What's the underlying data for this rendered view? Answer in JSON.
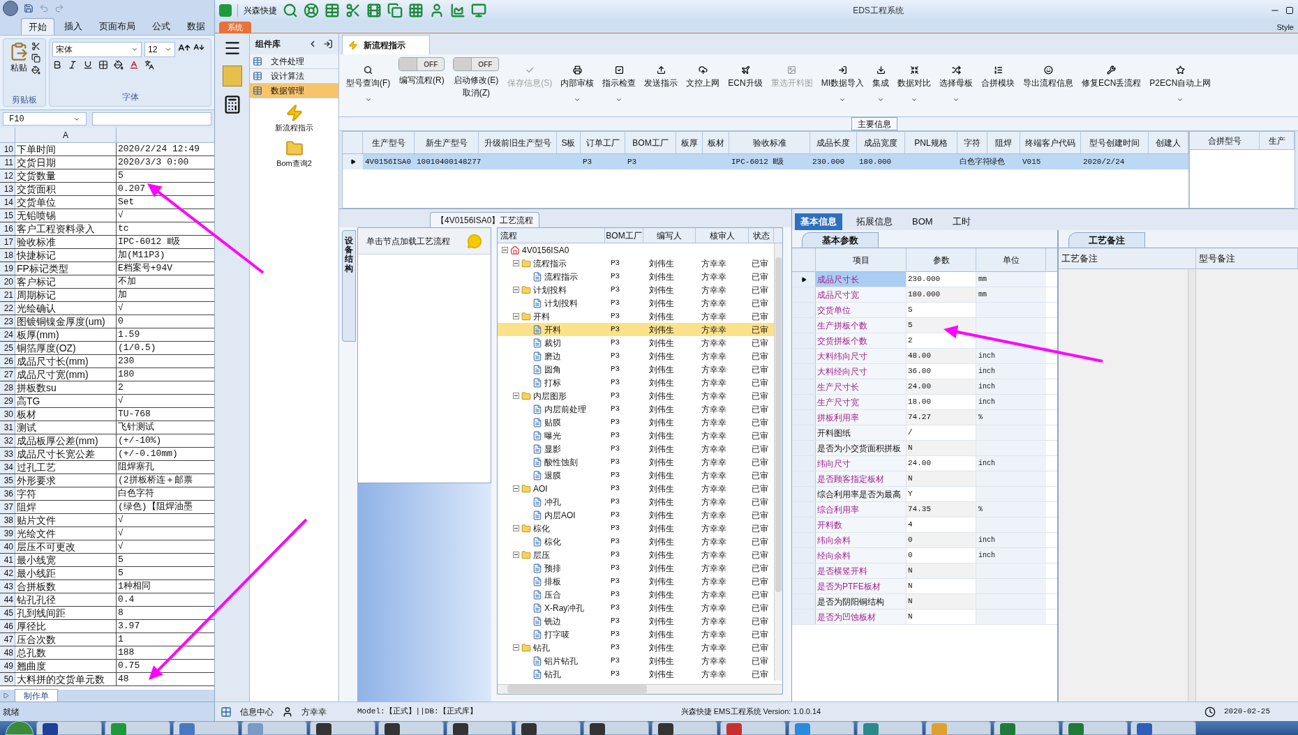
{
  "excel": {
    "tabs": [
      {
        "label": "开始",
        "selected": true
      },
      {
        "label": "插入",
        "selected": false
      },
      {
        "label": "页面布局",
        "selected": false
      },
      {
        "label": "公式",
        "selected": false
      },
      {
        "label": "数据",
        "selected": false
      }
    ],
    "paste_label": "粘贴",
    "clipboard_group": "剪贴板",
    "font_name": "宋体",
    "font_size": "12",
    "font_group": "字体",
    "name_box": "F10",
    "column_a": "A",
    "rows": [
      [
        "10",
        "下单时间",
        "2020/2/24 12:49"
      ],
      [
        "11",
        "交货日期",
        "2020/3/3 0:00"
      ],
      [
        "12",
        "交货数量",
        "5"
      ],
      [
        "13",
        "交货面积",
        "0.207"
      ],
      [
        "14",
        "交货单位",
        "Set"
      ],
      [
        "15",
        "无铅喷锡",
        "√"
      ],
      [
        "16",
        "客户工程资料录入",
        "tc"
      ],
      [
        "17",
        "验收标准",
        "IPC-6012 Ⅱ级"
      ],
      [
        "18",
        "快捷标记",
        "加(M11P3)"
      ],
      [
        "19",
        "FP标记类型",
        "E档案号+94V"
      ],
      [
        "20",
        "客户标记",
        "不加"
      ],
      [
        "21",
        "周期标记",
        "加"
      ],
      [
        "22",
        "光绘确认",
        "√"
      ],
      [
        "23",
        "图镀铜镍金厚度(um)",
        "0"
      ],
      [
        "24",
        "板厚(mm)",
        "1.59"
      ],
      [
        "25",
        "铜箔厚度(OZ)",
        "(1/0.5)"
      ],
      [
        "26",
        "成品尺寸长(mm)",
        "230"
      ],
      [
        "27",
        "成品尺寸宽(mm)",
        "180"
      ],
      [
        "28",
        "拼板数su",
        "2"
      ],
      [
        "29",
        "高TG",
        "√"
      ],
      [
        "30",
        "板材",
        "TU-768"
      ],
      [
        "31",
        "测试",
        "飞针测试"
      ],
      [
        "32",
        "成品板厚公差(mm)",
        "(+/-10%)"
      ],
      [
        "33",
        "成品尺寸长宽公差",
        "(+/-0.10mm)"
      ],
      [
        "34",
        "过孔工艺",
        "阻焊塞孔"
      ],
      [
        "35",
        "外形要求",
        "(2拼板桥连＋邮票"
      ],
      [
        "36",
        "字符",
        "白色字符"
      ],
      [
        "37",
        "阻焊",
        "(绿色)【阻焊油墨"
      ],
      [
        "38",
        "贴片文件",
        "√"
      ],
      [
        "39",
        "光绘文件",
        "√"
      ],
      [
        "40",
        "层压不可更改",
        "√"
      ],
      [
        "41",
        "最小线宽",
        "5"
      ],
      [
        "42",
        "最小线距",
        "5"
      ],
      [
        "43",
        "合拼板数",
        "1种相同"
      ],
      [
        "44",
        "钻孔孔径",
        "0.4"
      ],
      [
        "45",
        "孔到线间距",
        "8"
      ],
      [
        "46",
        "厚径比",
        "3.97"
      ],
      [
        "47",
        "压合次数",
        "1"
      ],
      [
        "48",
        "总孔数",
        "188"
      ],
      [
        "49",
        "翘曲度",
        "0.75"
      ],
      [
        "50",
        "大料拼的交货单元数",
        "48"
      ]
    ],
    "sheet_tab": "制作单",
    "status": "就绪"
  },
  "app": {
    "quick_label": "兴森快捷",
    "title": "EDS工程系统",
    "system_tab": "系统",
    "style_label": "Style",
    "library": {
      "title": "组件库",
      "items": [
        {
          "label": "文件处理",
          "selected": false
        },
        {
          "label": "设计算法",
          "selected": false
        },
        {
          "label": "数据管理",
          "selected": true
        }
      ],
      "tools": [
        {
          "kind": "lightning",
          "label": "新流程指示"
        },
        {
          "kind": "folder",
          "label": "Bom查询2"
        }
      ]
    },
    "doc_tab": "新流程指示",
    "ribbon": [
      {
        "kind": "button",
        "label": "型号查询(F)",
        "dropdown": true,
        "disabled": false
      },
      {
        "kind": "toggle",
        "label": "编写流程(R)",
        "state_text": "OFF",
        "on": false
      },
      {
        "kind": "toggle",
        "label": "启动修改(E)",
        "label2": "取消(Z)",
        "state_text": "OFF",
        "on": false
      },
      {
        "kind": "button",
        "label": "保存信息(S)",
        "dropdown": false,
        "disabled": true
      },
      {
        "kind": "button",
        "label": "内部审核",
        "dropdown": true,
        "disabled": false
      },
      {
        "kind": "button",
        "label": "指示检查",
        "dropdown": true,
        "disabled": false
      },
      {
        "kind": "button",
        "label": "发送指示",
        "dropdown": false,
        "disabled": false
      },
      {
        "kind": "button",
        "label": "文控上网",
        "dropdown": false,
        "disabled": false
      },
      {
        "kind": "button",
        "label": "ECN升级",
        "dropdown": false,
        "disabled": false
      },
      {
        "kind": "button",
        "label": "重选开料图",
        "dropdown": false,
        "disabled": true
      },
      {
        "kind": "button",
        "label": "MI数据导入",
        "dropdown": true,
        "disabled": false
      },
      {
        "kind": "button",
        "label": "集成",
        "dropdown": true,
        "disabled": false
      },
      {
        "kind": "button",
        "label": "数据对比",
        "dropdown": true,
        "disabled": false
      },
      {
        "kind": "button",
        "label": "选择母板",
        "dropdown": true,
        "disabled": false
      },
      {
        "kind": "button",
        "label": "合拼模块",
        "dropdown": false,
        "disabled": false
      },
      {
        "kind": "button",
        "label": "导出流程信息",
        "dropdown": false,
        "disabled": false
      },
      {
        "kind": "button",
        "label": "修复ECN丢流程",
        "dropdown": false,
        "disabled": false
      },
      {
        "kind": "button",
        "label": "P2ECN自动上网",
        "dropdown": true,
        "disabled": false
      }
    ],
    "main_info": {
      "title": "主要信息",
      "columns": [
        "生产型号",
        "新生产型号",
        "升级前旧生产型号",
        "S板",
        "订单工厂",
        "BOM工厂",
        "板厚",
        "板材",
        "验收标准",
        "成品长度",
        "成品宽度",
        "PNL规格",
        "字符",
        "阻焊",
        "终端客户代码",
        "型号创建时间",
        "创建人"
      ],
      "row": {
        "selected": true,
        "cells": [
          "4V0156ISA0",
          "10010400148277",
          null,
          null,
          "P3",
          "P3",
          null,
          null,
          "IPC-6012 Ⅱ级",
          "230.000",
          "180.000",
          null,
          "白色字符",
          "绿色",
          "V015",
          "2020/2/24",
          null
        ]
      },
      "side_columns": [
        "合拼型号",
        "生产"
      ]
    },
    "flow": {
      "title": "【4V0156ISA0】工艺流程",
      "side_tab": "设备结构",
      "hint": "单击节点加载工艺流程",
      "columns": [
        "流程",
        "BOM工厂",
        "编写人",
        "核审人",
        "状态"
      ],
      "tree": [
        {
          "name": "4V0156ISA0",
          "kind": "root",
          "selected": false,
          "expanded": true,
          "children": [
            {
              "name": "流程指示",
              "kind": "folder",
              "bom": "P3",
              "writer": "刘伟生",
              "reviewer": "方幸幸",
              "status": "已审",
              "selected": false,
              "expanded": true,
              "children": [
                {
                  "name": "流程指示",
                  "kind": "step",
                  "bom": "P3",
                  "writer": "刘伟生",
                  "reviewer": "方幸幸",
                  "status": "已审",
                  "selected": false
                }
              ]
            },
            {
              "name": "计划投料",
              "kind": "folder",
              "bom": "P3",
              "writer": "刘伟生",
              "reviewer": "方幸幸",
              "status": "已审",
              "selected": false,
              "expanded": true,
              "children": [
                {
                  "name": "计划投料",
                  "kind": "step",
                  "bom": "P3",
                  "writer": "刘伟生",
                  "reviewer": "方幸幸",
                  "status": "已审",
                  "selected": false
                }
              ]
            },
            {
              "name": "开料",
              "kind": "folder",
              "bom": "P3",
              "writer": "刘伟生",
              "reviewer": "方幸幸",
              "status": "已审",
              "selected": false,
              "expanded": true,
              "children": [
                {
                  "name": "开料",
                  "kind": "step",
                  "bom": "P3",
                  "writer": "刘伟生",
                  "reviewer": "方幸幸",
                  "status": "已审",
                  "selected": true
                },
                {
                  "name": "裁切",
                  "kind": "step",
                  "bom": "P3",
                  "writer": "刘伟生",
                  "reviewer": "方幸幸",
                  "status": "已审",
                  "selected": false
                },
                {
                  "name": "磨边",
                  "kind": "step",
                  "bom": "P3",
                  "writer": "刘伟生",
                  "reviewer": "方幸幸",
                  "status": "已审",
                  "selected": false
                },
                {
                  "name": "圆角",
                  "kind": "step",
                  "bom": "P3",
                  "writer": "刘伟生",
                  "reviewer": "方幸幸",
                  "status": "已审",
                  "selected": false
                },
                {
                  "name": "打标",
                  "kind": "step",
                  "bom": "P3",
                  "writer": "刘伟生",
                  "reviewer": "方幸幸",
                  "status": "已审",
                  "selected": false
                }
              ]
            },
            {
              "name": "内层图形",
              "kind": "folder",
              "bom": "P3",
              "writer": "刘伟生",
              "reviewer": "方幸幸",
              "status": "已审",
              "selected": false,
              "expanded": true,
              "children": [
                {
                  "name": "内层前处理",
                  "kind": "step",
                  "bom": "P3",
                  "writer": "刘伟生",
                  "reviewer": "方幸幸",
                  "status": "已审",
                  "selected": false
                },
                {
                  "name": "贴膜",
                  "kind": "step",
                  "bom": "P3",
                  "writer": "刘伟生",
                  "reviewer": "方幸幸",
                  "status": "已审",
                  "selected": false
                },
                {
                  "name": "曝光",
                  "kind": "step",
                  "bom": "P3",
                  "writer": "刘伟生",
                  "reviewer": "方幸幸",
                  "status": "已审",
                  "selected": false
                },
                {
                  "name": "显影",
                  "kind": "step",
                  "bom": "P3",
                  "writer": "刘伟生",
                  "reviewer": "方幸幸",
                  "status": "已审",
                  "selected": false
                },
                {
                  "name": "酸性蚀刻",
                  "kind": "step",
                  "bom": "P3",
                  "writer": "刘伟生",
                  "reviewer": "方幸幸",
                  "status": "已审",
                  "selected": false
                },
                {
                  "name": "退膜",
                  "kind": "step",
                  "bom": "P3",
                  "writer": "刘伟生",
                  "reviewer": "方幸幸",
                  "status": "已审",
                  "selected": false
                }
              ]
            },
            {
              "name": "AOI",
              "kind": "folder",
              "bom": "P3",
              "writer": "刘伟生",
              "reviewer": "方幸幸",
              "status": "已审",
              "selected": false,
              "expanded": true,
              "children": [
                {
                  "name": "冲孔",
                  "kind": "step",
                  "bom": "P3",
                  "writer": "刘伟生",
                  "reviewer": "方幸幸",
                  "status": "已审",
                  "selected": false
                },
                {
                  "name": "内层AOI",
                  "kind": "step",
                  "bom": "P3",
                  "writer": "刘伟生",
                  "reviewer": "方幸幸",
                  "status": "已审",
                  "selected": false
                }
              ]
            },
            {
              "name": "棕化",
              "kind": "folder",
              "bom": "P3",
              "writer": "刘伟生",
              "reviewer": "方幸幸",
              "status": "已审",
              "selected": false,
              "expanded": true,
              "children": [
                {
                  "name": "棕化",
                  "kind": "step",
                  "bom": "P3",
                  "writer": "刘伟生",
                  "reviewer": "方幸幸",
                  "status": "已审",
                  "selected": false
                }
              ]
            },
            {
              "name": "层压",
              "kind": "folder",
              "bom": "P3",
              "writer": "刘伟生",
              "reviewer": "方幸幸",
              "status": "已审",
              "selected": false,
              "expanded": true,
              "children": [
                {
                  "name": "预排",
                  "kind": "step",
                  "bom": "P3",
                  "writer": "刘伟生",
                  "reviewer": "方幸幸",
                  "status": "已审",
                  "selected": false
                },
                {
                  "name": "排板",
                  "kind": "step",
                  "bom": "P3",
                  "writer": "刘伟生",
                  "reviewer": "方幸幸",
                  "status": "已审",
                  "selected": false
                },
                {
                  "name": "压合",
                  "kind": "step",
                  "bom": "P3",
                  "writer": "刘伟生",
                  "reviewer": "方幸幸",
                  "status": "已审",
                  "selected": false
                },
                {
                  "name": "X-Ray冲孔",
                  "kind": "step",
                  "bom": "P3",
                  "writer": "刘伟生",
                  "reviewer": "方幸幸",
                  "status": "已审",
                  "selected": false
                },
                {
                  "name": "铣边",
                  "kind": "step",
                  "bom": "P3",
                  "writer": "刘伟生",
                  "reviewer": "方幸幸",
                  "status": "已审",
                  "selected": false
                },
                {
                  "name": "打字唛",
                  "kind": "step",
                  "bom": "P3",
                  "writer": "刘伟生",
                  "reviewer": "方幸幸",
                  "status": "已审",
                  "selected": false
                }
              ]
            },
            {
              "name": "钻孔",
              "kind": "folder",
              "bom": "P3",
              "writer": "刘伟生",
              "reviewer": "方幸幸",
              "status": "已审",
              "selected": false,
              "expanded": true,
              "children": [
                {
                  "name": "铝片钻孔",
                  "kind": "step",
                  "bom": "P3",
                  "writer": "刘伟生",
                  "reviewer": "方幸幸",
                  "status": "已审",
                  "selected": false
                },
                {
                  "name": "钻孔",
                  "kind": "step",
                  "bom": "P3",
                  "writer": "刘伟生",
                  "reviewer": "方幸幸",
                  "status": "已审",
                  "selected": false
                }
              ]
            }
          ]
        }
      ]
    },
    "details": {
      "tabs": [
        {
          "label": "基本信息",
          "selected": true
        },
        {
          "label": "拓展信息",
          "selected": false
        },
        {
          "label": "BOM",
          "selected": false
        },
        {
          "label": "工时",
          "selected": false
        }
      ],
      "params_tab": "基本参数",
      "columns": [
        "项目",
        "参数",
        "单位"
      ],
      "params": [
        {
          "name": "成品尺寸长",
          "value": "230.000",
          "unit": "mm",
          "emphasized": true,
          "selected": true
        },
        {
          "name": "成品尺寸宽",
          "value": "180.000",
          "unit": "mm",
          "emphasized": true,
          "selected": false
        },
        {
          "name": "交货单位",
          "value": "S",
          "emphasized": true,
          "selected": false
        },
        {
          "name": "生产拼板个数",
          "value": "5",
          "emphasized": true,
          "selected": false
        },
        {
          "name": "交货拼板个数",
          "value": "2",
          "emphasized": true,
          "selected": false
        },
        {
          "name": "大料纬向尺寸",
          "value": "48.00",
          "unit": "inch",
          "emphasized": true,
          "selected": false
        },
        {
          "name": "大料经向尺寸",
          "value": "36.00",
          "unit": "inch",
          "emphasized": true,
          "selected": false
        },
        {
          "name": "生产尺寸长",
          "value": "24.00",
          "unit": "inch",
          "emphasized": true,
          "selected": false
        },
        {
          "name": "生产尺寸宽",
          "value": "18.00",
          "unit": "inch",
          "emphasized": true,
          "selected": false
        },
        {
          "name": "拼板利用率",
          "value": "74.27",
          "unit": "%",
          "emphasized": true,
          "selected": false
        },
        {
          "name": "开料图纸",
          "value": "/",
          "emphasized": false,
          "selected": false
        },
        {
          "name": "是否为小交货面积拼板",
          "value": "N",
          "emphasized": false,
          "selected": false
        },
        {
          "name": "纬向尺寸",
          "value": "24.00",
          "unit": "inch",
          "emphasized": true,
          "selected": false
        },
        {
          "name": "是否顾客指定板材",
          "value": "N",
          "emphasized": true,
          "selected": false
        },
        {
          "name": "综合利用率是否为最高",
          "value": "Y",
          "emphasized": false,
          "selected": false
        },
        {
          "name": "综合利用率",
          "value": "74.35",
          "unit": "%",
          "emphasized": true,
          "selected": false
        },
        {
          "name": "开料数",
          "value": "4",
          "emphasized": true,
          "selected": false
        },
        {
          "name": "纬向余料",
          "value": "0",
          "unit": "inch",
          "emphasized": true,
          "selected": false
        },
        {
          "name": "经向余料",
          "value": "0",
          "unit": "inch",
          "emphasized": true,
          "selected": false
        },
        {
          "name": "是否横竖开料",
          "value": "N",
          "emphasized": true,
          "selected": false
        },
        {
          "name": "是否为PTFE板材",
          "value": "N",
          "emphasized": true,
          "selected": false
        },
        {
          "name": "是否为阴阳铜结构",
          "value": "N",
          "emphasized": false,
          "selected": false
        },
        {
          "name": "是否为凹蚀板材",
          "value": "N",
          "emphasized": true,
          "selected": false
        }
      ],
      "notes_tab": "工艺备注",
      "notes_columns": [
        "工艺备注",
        "型号备注"
      ]
    },
    "status_bar": {
      "info_center": "信息中心",
      "user": "方幸幸",
      "model": "Model:【正式】||DB:【正式库】",
      "version": "兴森快捷 EMS工程系统 Version: 1.0.0.14",
      "date": "2020-02-25"
    }
  }
}
